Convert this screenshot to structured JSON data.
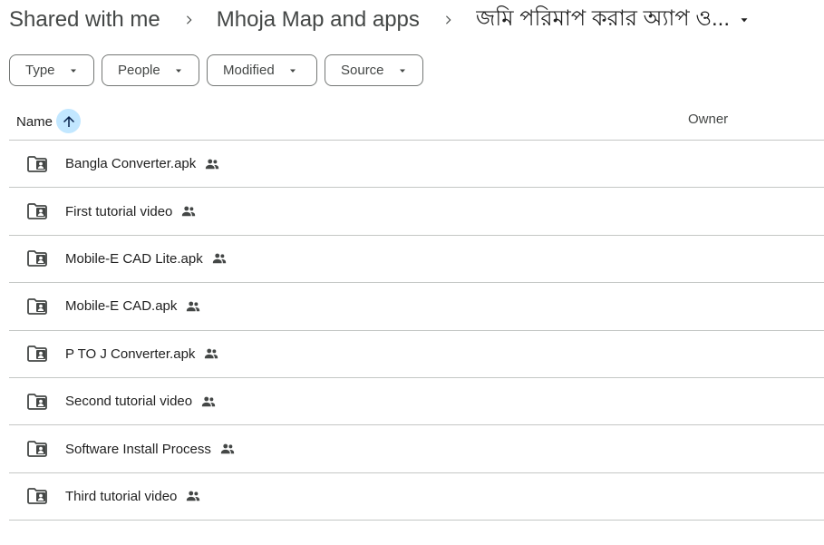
{
  "breadcrumb": {
    "items": [
      "Shared with me",
      "Mhoja Map and apps"
    ],
    "current": "জমি পরিমাপ করার অ্যাপ ও..."
  },
  "filters": {
    "type": "Type",
    "people": "People",
    "modified": "Modified",
    "source": "Source"
  },
  "table": {
    "columns": {
      "name": "Name",
      "owner": "Owner"
    },
    "sort": "ascending",
    "rows": [
      {
        "name": "Bangla Converter.apk",
        "icon": "shared-folder-icon",
        "shared": true
      },
      {
        "name": "First tutorial video",
        "icon": "shared-folder-icon",
        "shared": true
      },
      {
        "name": "Mobile-E CAD Lite.apk",
        "icon": "shared-folder-icon",
        "shared": true
      },
      {
        "name": "Mobile-E CAD.apk",
        "icon": "shared-folder-icon",
        "shared": true
      },
      {
        "name": "P TO J Converter.apk",
        "icon": "shared-folder-icon",
        "shared": true
      },
      {
        "name": "Second tutorial video",
        "icon": "shared-folder-icon",
        "shared": true
      },
      {
        "name": "Software Install Process",
        "icon": "shared-folder-icon",
        "shared": true
      },
      {
        "name": "Third tutorial video",
        "icon": "shared-folder-icon",
        "shared": true
      }
    ]
  },
  "colors": {
    "text": "#1f1f1f",
    "secondary": "#444746",
    "divider": "#c4c7c5",
    "sort_bg": "#c2e7ff",
    "sort_arrow": "#041e49"
  }
}
